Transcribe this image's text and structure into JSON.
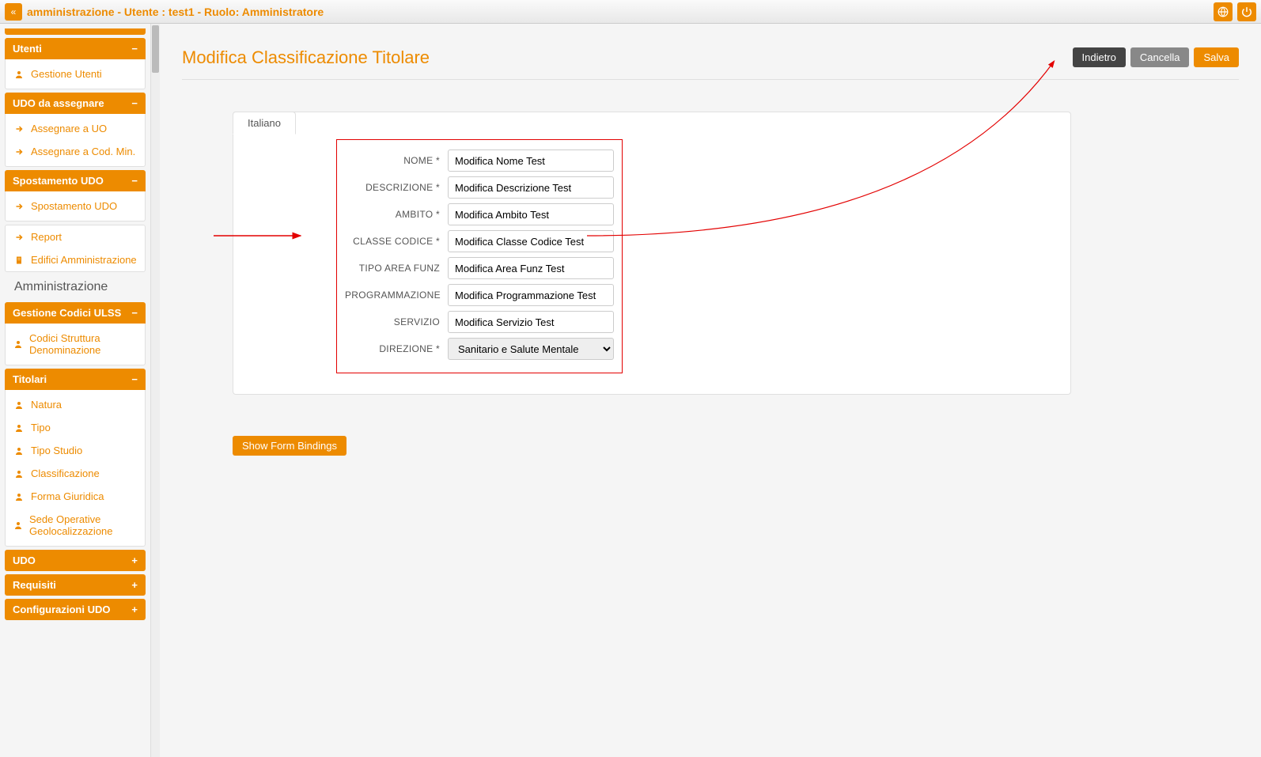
{
  "topbar": {
    "title": "amministrazione - Utente : test1 - Ruolo: Amministratore"
  },
  "sidebar": {
    "sections": [
      {
        "title": "Utenti",
        "toggle": "−",
        "items": [
          {
            "icon": "user",
            "label": "Gestione Utenti"
          }
        ]
      },
      {
        "title": "UDO da assegnare",
        "toggle": "−",
        "items": [
          {
            "icon": "arrow",
            "label": "Assegnare a UO"
          },
          {
            "icon": "arrow",
            "label": "Assegnare a Cod. Min."
          }
        ]
      },
      {
        "title": "Spostamento UDO",
        "toggle": "−",
        "items": [
          {
            "icon": "arrow",
            "label": "Spostamento UDO"
          }
        ]
      }
    ],
    "plain": [
      {
        "icon": "arrow",
        "label": "Report"
      },
      {
        "icon": "building",
        "label": "Edifici Amministrazione"
      }
    ],
    "section_label": "Amministrazione",
    "sections2": [
      {
        "title": "Gestione Codici ULSS",
        "toggle": "−",
        "items": [
          {
            "icon": "user",
            "label": "Codici Struttura Denominazione"
          }
        ]
      },
      {
        "title": "Titolari",
        "toggle": "−",
        "items": [
          {
            "icon": "user",
            "label": "Natura"
          },
          {
            "icon": "user",
            "label": "Tipo"
          },
          {
            "icon": "user",
            "label": "Tipo Studio"
          },
          {
            "icon": "user",
            "label": "Classificazione"
          },
          {
            "icon": "user",
            "label": "Forma Giuridica"
          },
          {
            "icon": "user",
            "label": "Sede Operative Geolocalizzazione"
          }
        ]
      },
      {
        "title": "UDO",
        "toggle": "+",
        "items": []
      },
      {
        "title": "Requisiti",
        "toggle": "+",
        "items": []
      },
      {
        "title": "Configurazioni UDO",
        "toggle": "+",
        "items": []
      }
    ]
  },
  "page": {
    "title": "Modifica Classificazione Titolare",
    "buttons": {
      "back": "Indietro",
      "cancel": "Cancella",
      "save": "Salva"
    },
    "tab": "Italiano",
    "form": {
      "fields": [
        {
          "label": "NOME *",
          "value": "Modifica Nome Test",
          "type": "text"
        },
        {
          "label": "DESCRIZIONE *",
          "value": "Modifica Descrizione Test",
          "type": "text"
        },
        {
          "label": "AMBITO *",
          "value": "Modifica Ambito Test",
          "type": "text"
        },
        {
          "label": "CLASSE CODICE *",
          "value": "Modifica Classe Codice Test",
          "type": "text"
        },
        {
          "label": "TIPO AREA FUNZ",
          "value": "Modifica Area Funz Test",
          "type": "text"
        },
        {
          "label": "PROGRAMMAZIONE",
          "value": "Modifica Programmazione Test",
          "type": "text"
        },
        {
          "label": "SERVIZIO",
          "value": "Modifica Servizio Test",
          "type": "text"
        },
        {
          "label": "DIREZIONE *",
          "value": "Sanitario e Salute Mentale",
          "type": "select"
        }
      ]
    },
    "show_bindings": "Show Form Bindings"
  }
}
